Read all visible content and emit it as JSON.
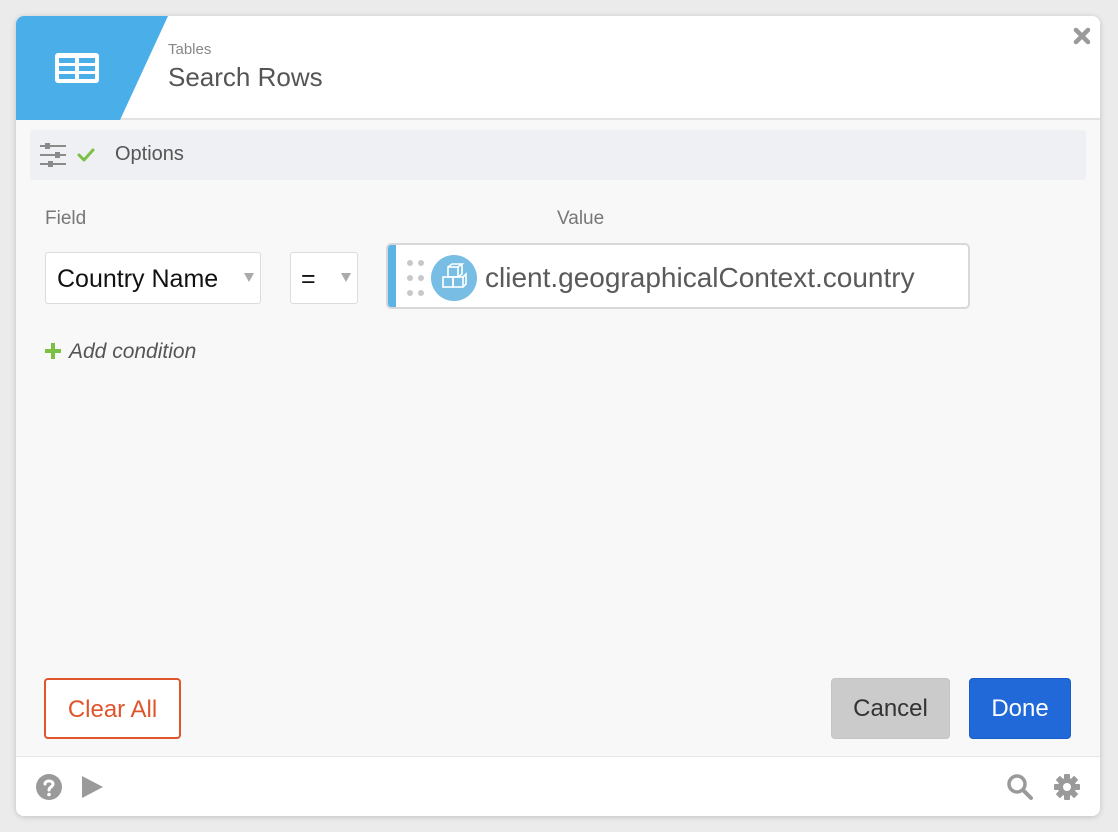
{
  "header": {
    "category": "Tables",
    "title": "Search Rows",
    "badge_color": "#4aaee8",
    "icon": "table-icon"
  },
  "options_bar": {
    "label": "Options",
    "icons": [
      "sliders-icon",
      "check-icon"
    ]
  },
  "columns": {
    "field_label": "Field",
    "value_label": "Value"
  },
  "condition": {
    "field": "Country Name",
    "operator": "=",
    "value": "client.geographicalContext.country",
    "value_icon": "object-icon"
  },
  "add_condition_label": "Add condition",
  "buttons": {
    "clear_all": "Clear All",
    "cancel": "Cancel",
    "done": "Done"
  },
  "colors": {
    "accent_blue": "#2168d8",
    "danger": "#e0552b",
    "success": "#7ac143"
  },
  "bottom_bar_icons": [
    "help-icon",
    "play-icon",
    "search-icon",
    "gear-icon"
  ]
}
